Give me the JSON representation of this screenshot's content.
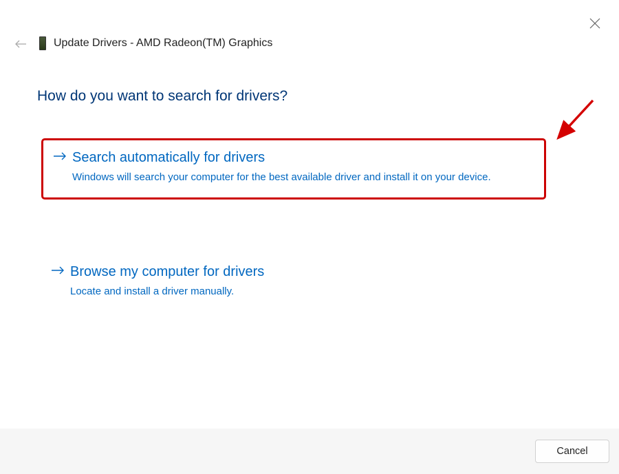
{
  "window": {
    "title": "Update Drivers - AMD Radeon(TM) Graphics"
  },
  "heading": "How do you want to search for drivers?",
  "options": {
    "auto": {
      "title": "Search automatically for drivers",
      "description": "Windows will search your computer for the best available driver and install it on your device."
    },
    "browse": {
      "title": "Browse my computer for drivers",
      "description": "Locate and install a driver manually."
    }
  },
  "footer": {
    "cancel": "Cancel"
  }
}
